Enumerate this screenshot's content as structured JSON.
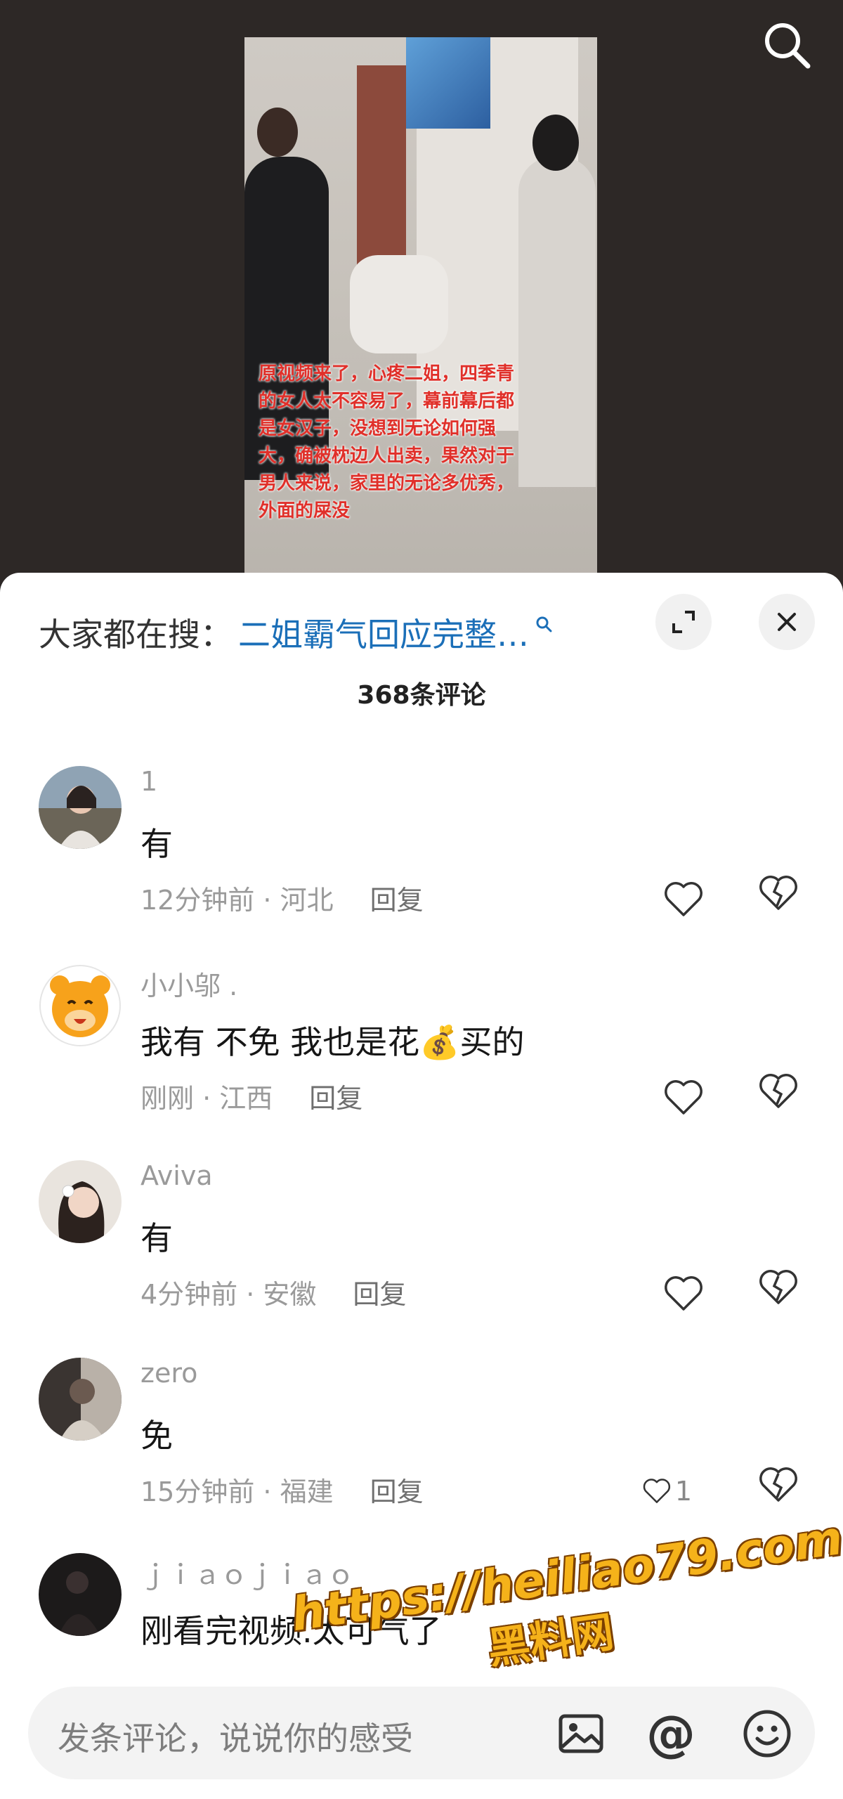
{
  "video": {
    "overlay_caption": "原视频来了，心疼二姐，四季青的女人太不容易了，幕前幕后都是女汉子，没想到无论如何强大，确被枕边人出卖，果然对于男人来说，家里的无论多优秀，外面的屎没"
  },
  "header": {
    "search_prefix": "大家都在搜：",
    "search_term": "二姐霸气回应完整…",
    "comment_count": "368条评论"
  },
  "comments": [
    {
      "name": "1",
      "text": "有",
      "time": "12分钟前 · 河北",
      "reply": "回复",
      "likes": ""
    },
    {
      "name": "小小邬 .",
      "text": "我有 不免 我也是花💰买的",
      "time": "刚刚 · 江西",
      "reply": "回复",
      "likes": ""
    },
    {
      "name": "Aviva",
      "text": "有",
      "time": "4分钟前 · 安徽",
      "reply": "回复",
      "likes": ""
    },
    {
      "name": "zero",
      "text": "免",
      "time": "15分钟前 · 福建",
      "reply": "回复",
      "likes": "1"
    },
    {
      "name": "ｊｉａｏｊｉａｏ",
      "text": "刚看完视频.太可气了",
      "time": "",
      "reply": "",
      "likes": ""
    }
  ],
  "input": {
    "placeholder": "发条评论，说说你的感受",
    "at_symbol": "@"
  },
  "watermark": {
    "url": "https://heiliao79.com",
    "name": "黑料网"
  },
  "icons": [
    "search-icon",
    "expand-icon",
    "close-icon",
    "heart-icon",
    "broken-heart-icon",
    "image-icon",
    "at-icon",
    "emoji-icon"
  ],
  "colors": {
    "link_blue": "#1b6fb8",
    "overlay_red": "#e0302a",
    "watermark_orange": "#f5b21a"
  }
}
